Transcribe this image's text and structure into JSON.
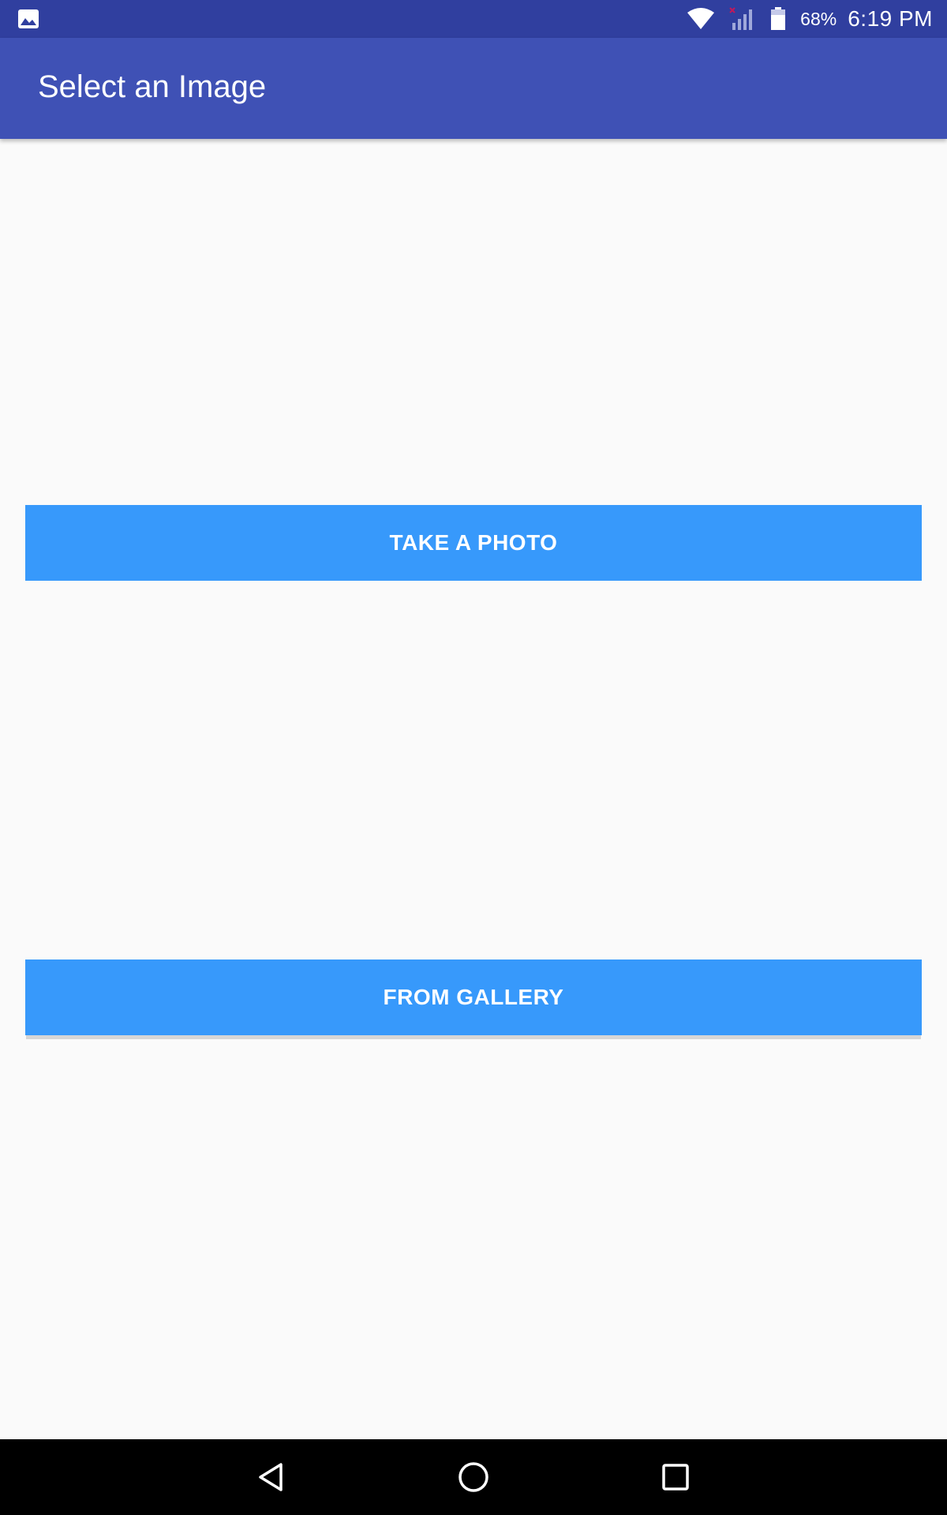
{
  "status_bar": {
    "notification_icon": "image-icon",
    "wifi_icon": "wifi-icon",
    "signal_icon": "signal-icon",
    "battery_icon": "battery-icon",
    "battery_percent": "68%",
    "time": "6:19 PM",
    "background_color": "#303f9f"
  },
  "app_bar": {
    "title": "Select an Image",
    "background_color": "#3f51b5"
  },
  "main": {
    "take_photo_label": "TAKE A PHOTO",
    "from_gallery_label": "FROM GALLERY",
    "button_color": "#3799fb"
  },
  "nav_bar": {
    "back_icon": "back-icon",
    "home_icon": "home-icon",
    "recents_icon": "recents-icon"
  }
}
